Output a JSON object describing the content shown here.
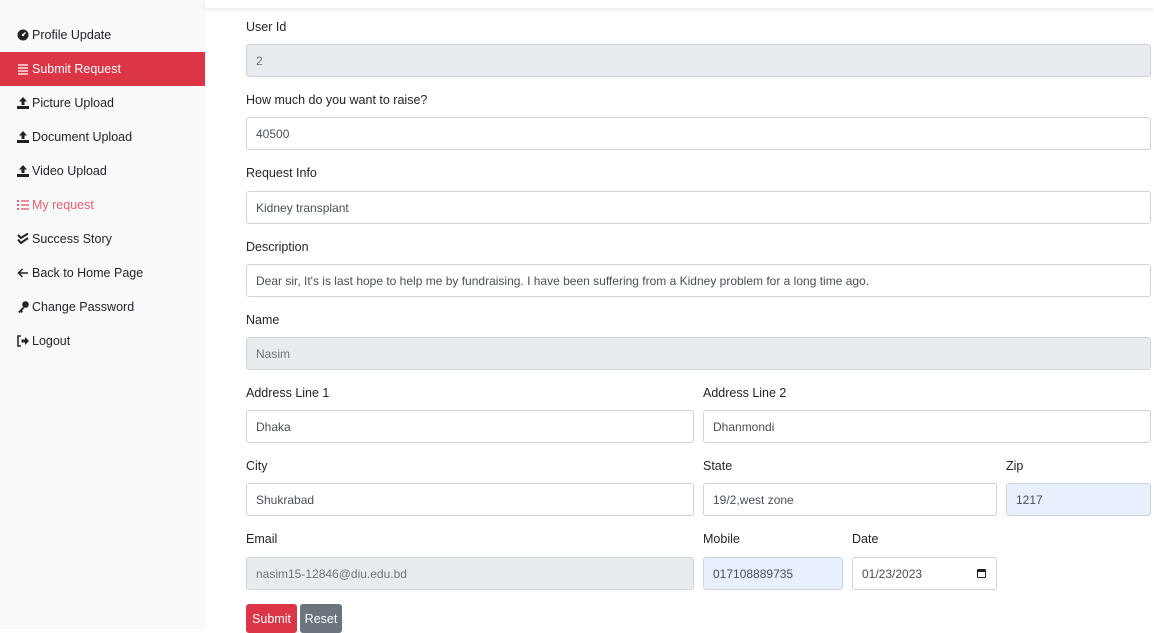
{
  "sidebar": {
    "items": [
      {
        "label": "Profile Update",
        "icon": "tachometer-icon"
      },
      {
        "label": "Submit Request",
        "icon": "list-icon"
      },
      {
        "label": "Picture Upload",
        "icon": "upload-icon"
      },
      {
        "label": "Document Upload",
        "icon": "upload-icon"
      },
      {
        "label": "Video Upload",
        "icon": "upload-icon"
      },
      {
        "label": "My request",
        "icon": "list-ol-icon"
      },
      {
        "label": "Success Story",
        "icon": "check-double-icon"
      },
      {
        "label": "Back to Home Page",
        "icon": "arrow-left-icon"
      },
      {
        "label": "Change Password",
        "icon": "key-icon"
      },
      {
        "label": "Logout",
        "icon": "sign-out-icon"
      }
    ],
    "active_index": 1
  },
  "colors": {
    "accent": "#dc3545",
    "sidebar_bg": "#f8f9fa",
    "readonly_bg": "#e9ecef",
    "autofill_bg": "#e8f0fe",
    "secondary": "#6c757d"
  },
  "form": {
    "user_id": {
      "label": "User Id",
      "value": "2"
    },
    "amount": {
      "label": "How much do you want to raise?",
      "value": "40500"
    },
    "request_info": {
      "label": "Request Info",
      "value": "Kidney transplant"
    },
    "description": {
      "label": "Description",
      "value": "Dear sir, It's is last hope to help me by fundraising. I have been suffering from a Kidney problem for a long time ago."
    },
    "name": {
      "label": "Name",
      "value": "Nasim"
    },
    "address1": {
      "label": "Address Line 1",
      "value": "Dhaka"
    },
    "address2": {
      "label": "Address Line 2",
      "value": "Dhanmondi"
    },
    "city": {
      "label": "City",
      "value": "Shukrabad"
    },
    "state": {
      "label": "State",
      "value": "19/2,west zone"
    },
    "zip": {
      "label": "Zip",
      "value": "1217"
    },
    "email": {
      "label": "Email",
      "value": "nasim15-12846@diu.edu.bd"
    },
    "mobile": {
      "label": "Mobile",
      "value": "017108889735"
    },
    "date": {
      "label": "Date",
      "value": "01/23/2023"
    },
    "submit_label": "Submit",
    "reset_label": "Reset"
  }
}
